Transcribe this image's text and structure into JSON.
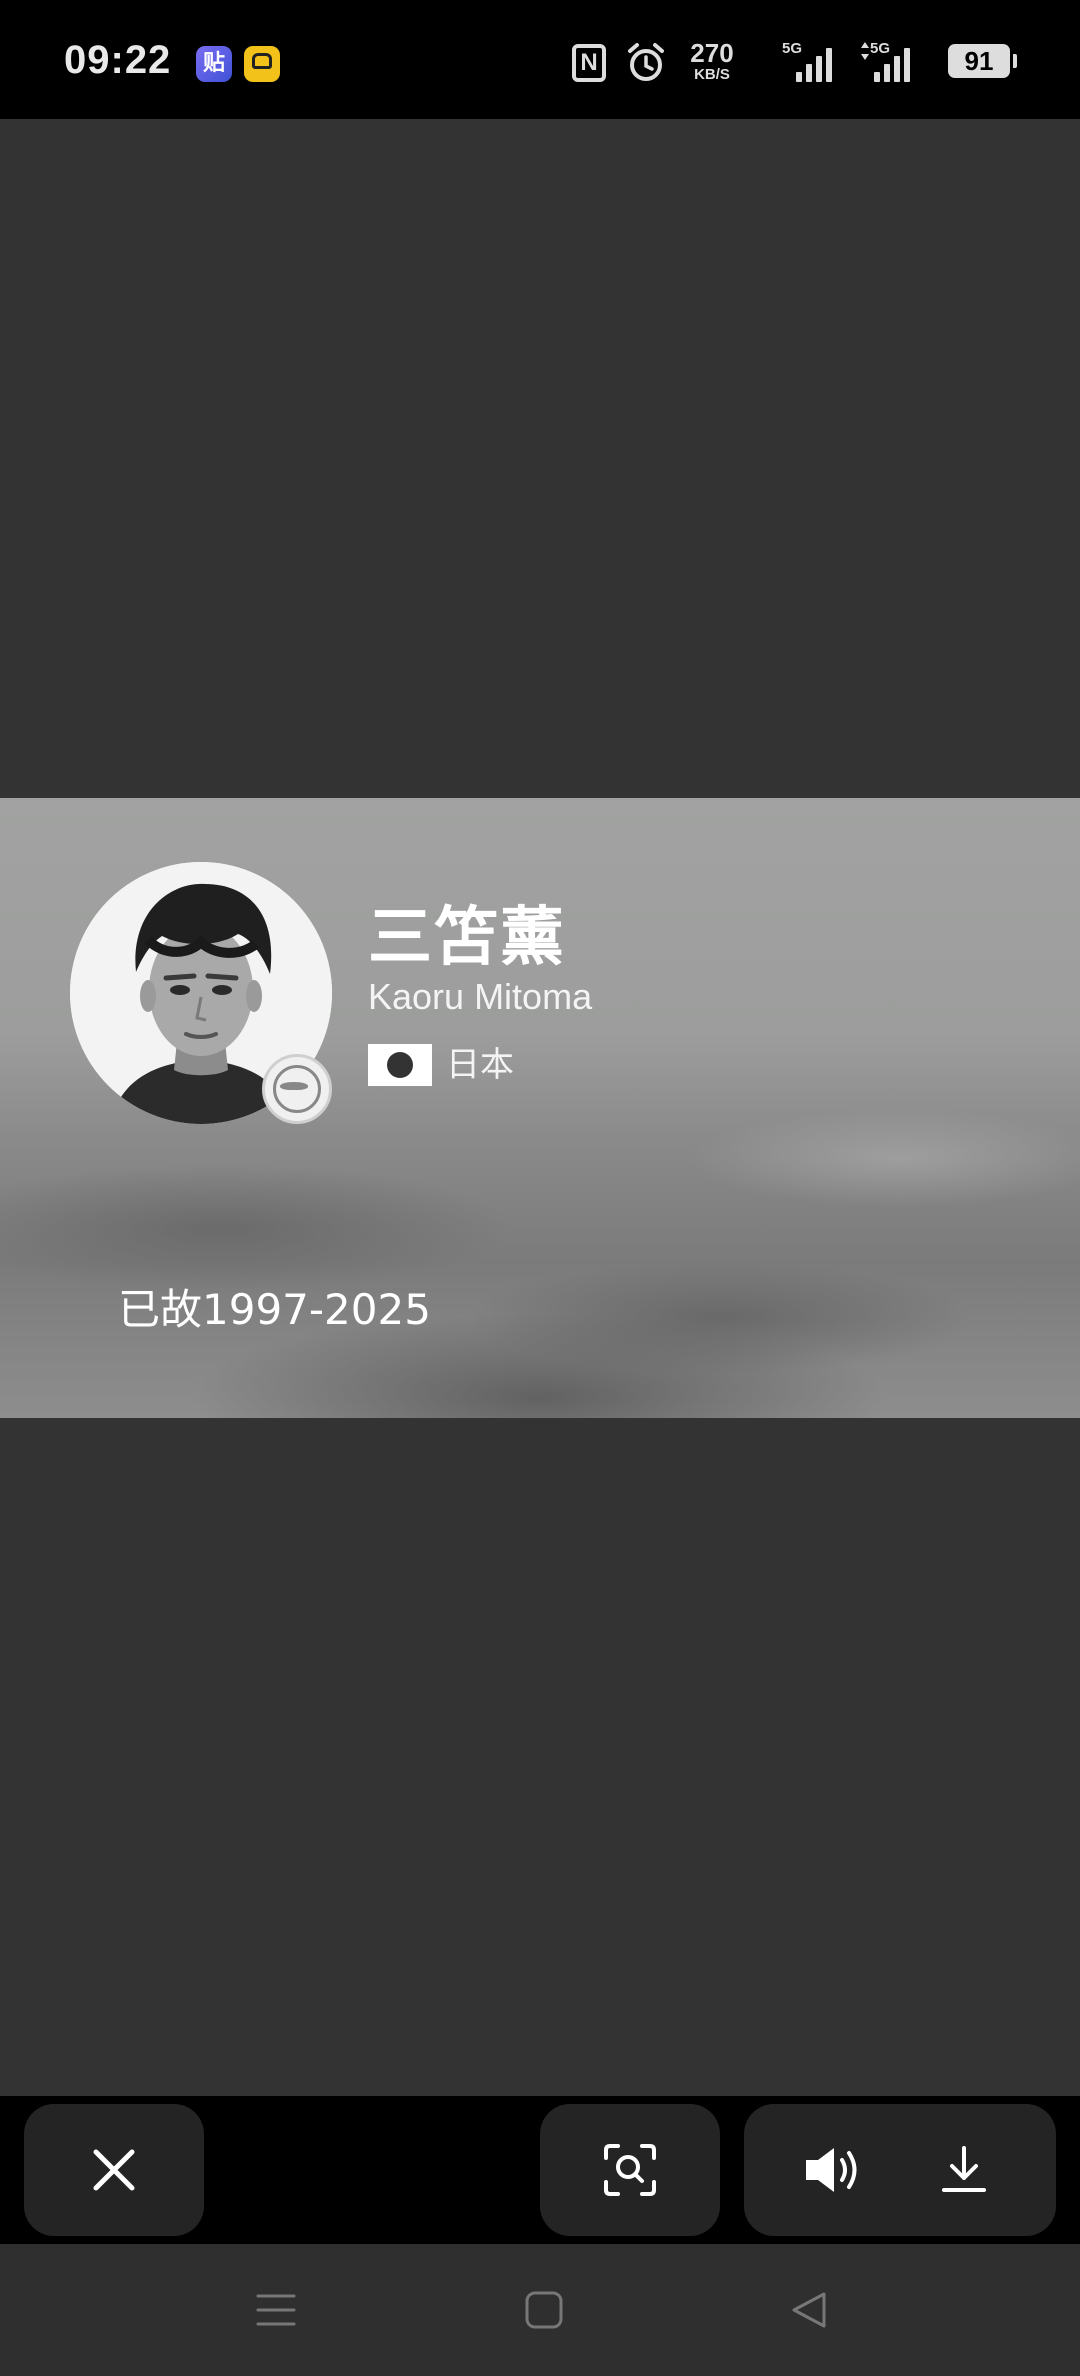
{
  "status_bar": {
    "time": "09:22",
    "app_icon_1": "贴",
    "nfc": "N",
    "net_speed_value": "270",
    "net_speed_unit": "KB/S",
    "signal_1_label": "5G",
    "signal_2_label": "5G",
    "battery": "91"
  },
  "player_card": {
    "name_chinese": "三笘薰",
    "name_latin": "Kaoru Mitoma",
    "country": "日本",
    "memorial_text": "已故1997-2025"
  },
  "toolbar": {
    "close_icon": "close-icon",
    "lens_icon": "image-search-icon",
    "sound_icon": "speaker-icon",
    "download_icon": "download-icon"
  },
  "navbar": {
    "menu_icon": "menu-icon",
    "home_icon": "home-icon",
    "back_icon": "back-icon"
  },
  "colors": {
    "background": "#333333",
    "status_bar": "#000000",
    "toolbar_button": "#242424"
  }
}
